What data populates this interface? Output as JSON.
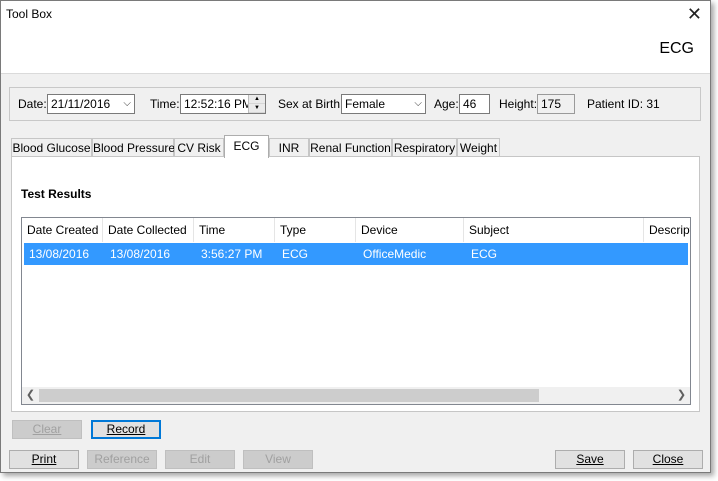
{
  "window": {
    "title": "Tool Box",
    "heading": "ECG"
  },
  "patient": {
    "date_label": "Date:",
    "date_value": "21/11/2016",
    "time_label": "Time:",
    "time_value": "12:52:16 PM",
    "sex_label": "Sex at Birth:",
    "sex_value": "Female",
    "age_label": "Age:",
    "age_value": "46",
    "height_label": "Height:",
    "height_value": "175",
    "patient_id_text": "Patient ID: 31"
  },
  "tabs": [
    {
      "label": "Blood Glucose"
    },
    {
      "label": "Blood Pressure"
    },
    {
      "label": "CV Risk"
    },
    {
      "label": "ECG"
    },
    {
      "label": "INR"
    },
    {
      "label": "Renal Function"
    },
    {
      "label": "Respiratory"
    },
    {
      "label": "Weight"
    }
  ],
  "active_tab": "ECG",
  "results": {
    "title": "Test Results",
    "columns": [
      "Date Created",
      "Date Collected",
      "Time",
      "Type",
      "Device",
      "Subject",
      "Descript"
    ],
    "rows": [
      {
        "cells": [
          "13/08/2016",
          "13/08/2016",
          "3:56:27 PM",
          "ECG",
          "OfficeMedic",
          "ECG",
          ""
        ]
      }
    ]
  },
  "actions": {
    "clear": "Clear",
    "record": "Record"
  },
  "footer": {
    "print": "Print",
    "reference": "Reference",
    "edit": "Edit",
    "view": "View",
    "save": "Save",
    "close": "Close"
  },
  "colors": {
    "selection": "#3399ff",
    "default_button_border": "#0078d7"
  }
}
